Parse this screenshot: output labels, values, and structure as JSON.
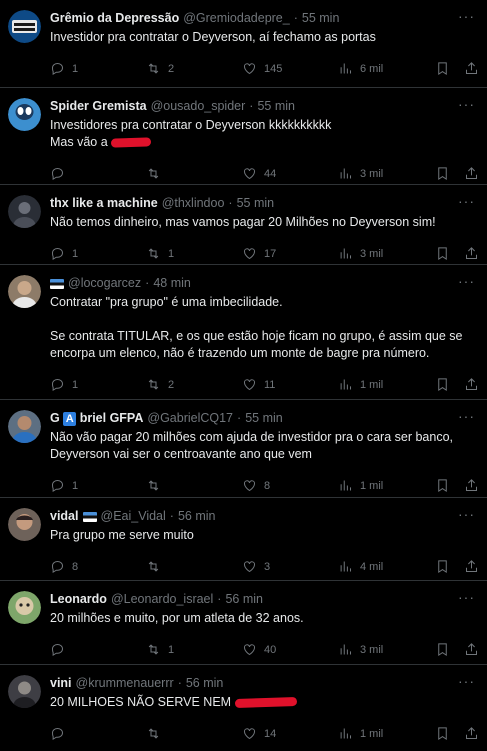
{
  "tweets": [
    {
      "name": "Grêmio da Depressão",
      "handle": "@Gremiodadepre_",
      "time": "55 min",
      "text": "Investidor pra contratar o Deyverson, aí fechamo as portas",
      "replies": "1",
      "retweets": "2",
      "likes": "145",
      "views": "6 mil",
      "avatar_color": "#1a5fa0"
    },
    {
      "name": "Spider Gremista",
      "handle": "@ousado_spider",
      "time": "55 min",
      "text_line1": "Investidores pra contratar o Deyverson kkkkkkkkkk",
      "text_line2": "Mas vão a",
      "replies": "",
      "retweets": "",
      "likes": "44",
      "views": "3 mil",
      "avatar_color": "#5aa8e0"
    },
    {
      "name": "thx like a machine",
      "handle": "@thxlindoo",
      "time": "55 min",
      "text": "Não temos dinheiro, mas vamos pagar 20 Milhões no Deyverson sim!",
      "replies": "1",
      "retweets": "1",
      "likes": "17",
      "views": "3 mil",
      "avatar_color": "#3a3f4a"
    },
    {
      "name": "",
      "handle": "@locogarcez",
      "time": "48 min",
      "text": "Contratar \"pra grupo\" é uma imbecilidade.\n\nSe contrata TITULAR, e os que estão hoje ficam no grupo, é assim que se encorpa um elenco, não é trazendo um monte de bagre pra número.",
      "replies": "1",
      "retweets": "2",
      "likes": "11",
      "views": "1 mil",
      "avatar_color": "#8a7a6a"
    },
    {
      "name_prefix": "G",
      "name_badge": "A",
      "name_suffix": "briel GFPA",
      "handle": "@GabrielCQ17",
      "time": "55 min",
      "text": "Não vão pagar 20 milhões com ajuda de investidor pra o cara ser banco, Deyverson vai ser o centroavante ano que vem",
      "replies": "1",
      "retweets": "",
      "likes": "8",
      "views": "1 mil",
      "avatar_color": "#5a6b7a"
    },
    {
      "name": "vidal",
      "handle": "@Eai_Vidal",
      "time": "56 min",
      "text": "Pra grupo me serve muito",
      "replies": "8",
      "retweets": "",
      "likes": "3",
      "views": "4 mil",
      "avatar_color": "#7a6a60"
    },
    {
      "name": "Leonardo",
      "handle": "@Leonardo_israel",
      "time": "56 min",
      "text": "20 milhões e muito, por um atleta de 32 anos.",
      "replies": "",
      "retweets": "1",
      "likes": "40",
      "views": "3 mil",
      "avatar_color": "#6a8a5a"
    },
    {
      "name": "vini",
      "handle": "@krummenauerrr",
      "time": "56 min",
      "text": "20 MILHOES NÃO SERVE NEM",
      "replies": "",
      "retweets": "",
      "likes": "14",
      "views": "1 mil",
      "avatar_color": "#4a4a50"
    }
  ],
  "colors": {
    "muted": "#71767b",
    "divider": "#2f3336",
    "redaction": "#e0112b"
  }
}
